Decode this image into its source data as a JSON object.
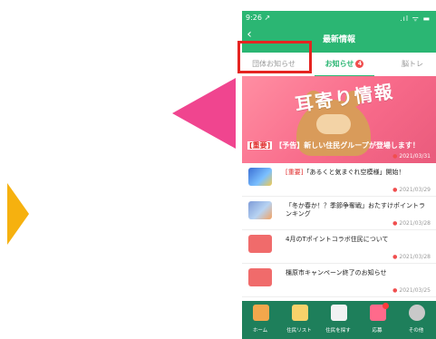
{
  "colors": {
    "brand_green": "#2bb673",
    "nav_green": "#1e7f5b",
    "highlight_red": "#e52421",
    "arrow_pink": "#f0458f",
    "arrow_orange": "#f6b10f",
    "badge_red": "#f04e4e"
  },
  "status_bar": {
    "time": "9:26 ↗",
    "right_icons": ".ıl ᯤ ▬"
  },
  "header": {
    "back_icon": "chevron-left-icon",
    "back_label": "‹",
    "title": "最新情報"
  },
  "tabs": [
    {
      "label": "団体お知らせ"
    },
    {
      "label": "お知らせ",
      "badge": "4"
    },
    {
      "label": "脳トレ"
    }
  ],
  "banner": {
    "art_text": "耳寄り情報",
    "tag": "[重要]",
    "headline": "【予告】新しい住民グループが登場します！",
    "date": "2021/03/31"
  },
  "news": [
    {
      "tag": "[重要]",
      "title": "「あるくと気まぐれ空模様」開始！",
      "date": "2021/03/29"
    },
    {
      "tag": "",
      "title": "「冬か春か！？季節争奪戦」おたすけポイントランキング",
      "date": "2021/03/28"
    },
    {
      "tag": "",
      "title": "4月のTポイントコラボ住民について",
      "date": "2021/03/28"
    },
    {
      "tag": "",
      "title": "橿原市キャンペーン終了のお知らせ",
      "date": "2021/03/25"
    }
  ],
  "bottom_nav": [
    {
      "label": "ホーム",
      "icon": "home-icon"
    },
    {
      "label": "住民リスト",
      "icon": "resident-list-icon"
    },
    {
      "label": "住民を探す",
      "icon": "binoculars-icon"
    },
    {
      "label": "応募",
      "icon": "gift-icon"
    },
    {
      "label": "その他",
      "icon": "gear-icon"
    }
  ]
}
